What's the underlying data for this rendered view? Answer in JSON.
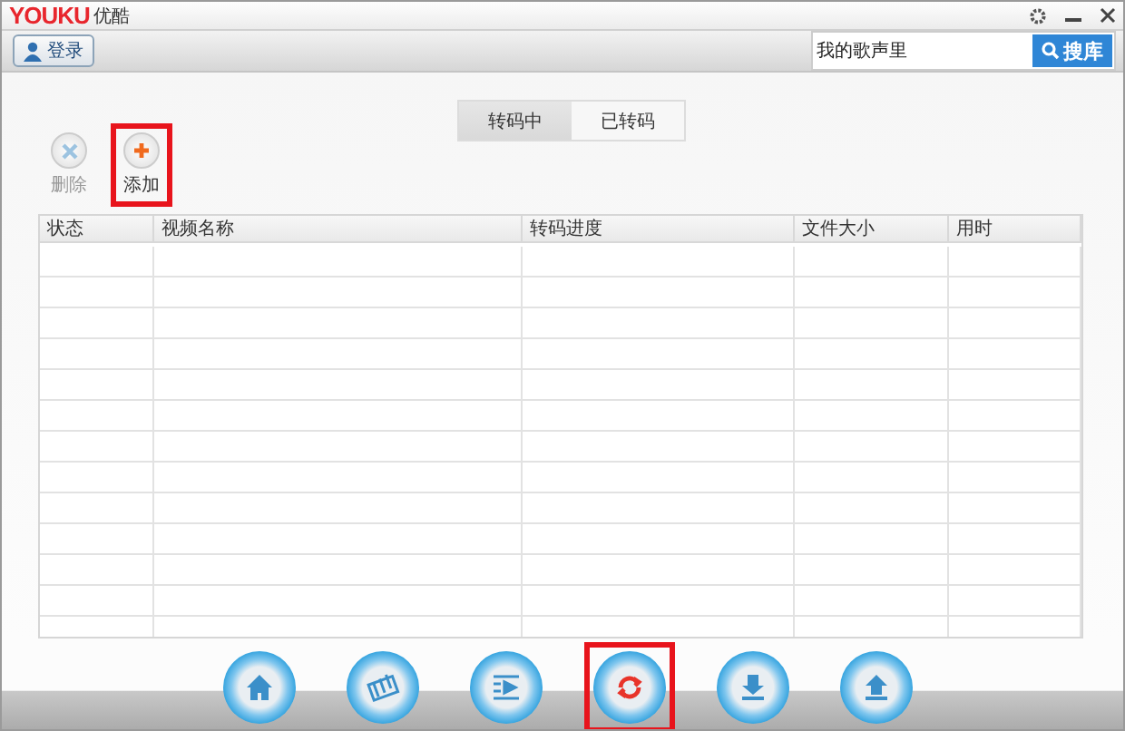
{
  "app": {
    "logo_latin": "YOUKU",
    "logo_cjk": "优酷"
  },
  "login_button": {
    "label": "登录"
  },
  "search": {
    "value": "我的歌声里",
    "button": "搜库"
  },
  "tabs": [
    {
      "label": "转码中",
      "selected": true
    },
    {
      "label": "已转码",
      "selected": false
    }
  ],
  "actions": [
    {
      "kind": "delete",
      "label": "删除",
      "highlighted": false
    },
    {
      "kind": "add",
      "label": "添加",
      "highlighted": true
    }
  ],
  "table": {
    "columns": [
      "状态",
      "视频名称",
      "转码进度",
      "文件大小",
      "用时"
    ]
  },
  "dock": [
    {
      "kind": "home",
      "highlighted": false
    },
    {
      "kind": "film",
      "highlighted": false
    },
    {
      "kind": "playlist",
      "highlighted": false
    },
    {
      "kind": "convert",
      "highlighted": true
    },
    {
      "kind": "download",
      "highlighted": false
    },
    {
      "kind": "upload",
      "highlighted": false
    }
  ]
}
